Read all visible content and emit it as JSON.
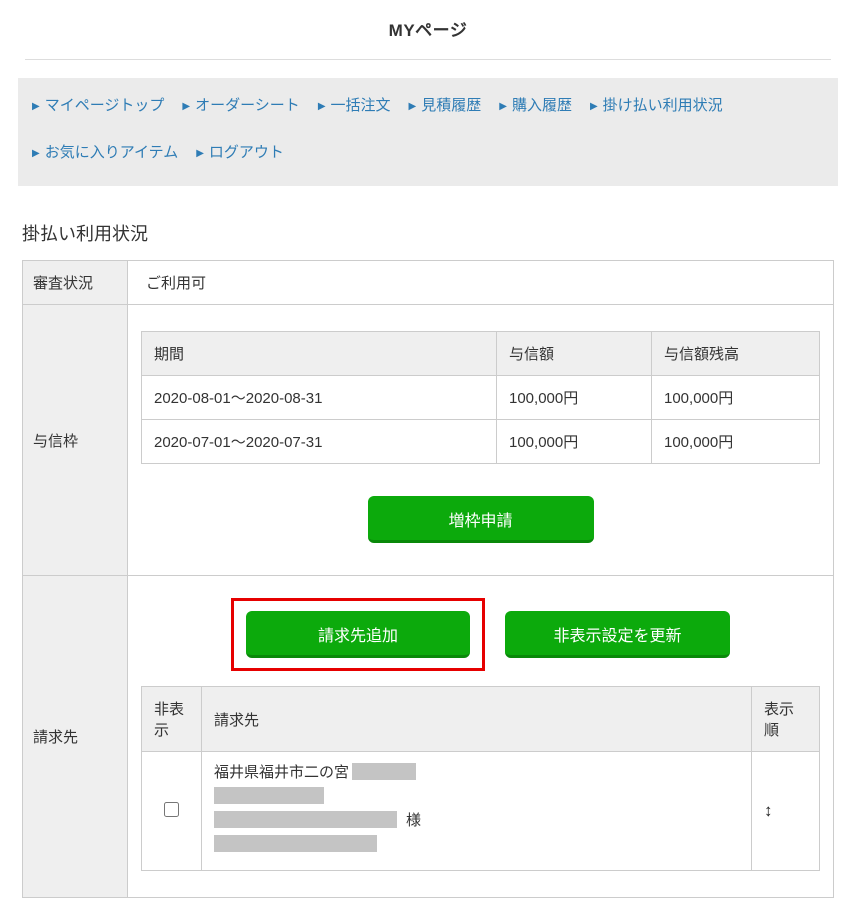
{
  "page": {
    "title": "MYページ"
  },
  "nav": {
    "marker": "▶",
    "items": [
      {
        "label": "マイページトップ"
      },
      {
        "label": "オーダーシート"
      },
      {
        "label": "一括注文"
      },
      {
        "label": "見積履歴"
      },
      {
        "label": "購入履歴"
      },
      {
        "label": "掛け払い利用状況"
      },
      {
        "label": "お気に入りアイテム"
      },
      {
        "label": "ログアウト"
      }
    ]
  },
  "section": {
    "heading": "掛払い利用状況"
  },
  "status": {
    "label": "審査状況",
    "value": "ご利用可"
  },
  "credit": {
    "label": "与信枠",
    "table": {
      "headers": [
        "期間",
        "与信額",
        "与信額残高"
      ],
      "rows": [
        [
          "2020-08-01〜2020-08-31",
          "100,000円",
          "100,000円"
        ],
        [
          "2020-07-01〜2020-07-31",
          "100,000円",
          "100,000円"
        ]
      ]
    },
    "increase_button_label": "増枠申請"
  },
  "billing": {
    "label": "請求先",
    "add_button_label": "請求先追加",
    "update_button_label": "非表示設定を更新",
    "table": {
      "headers": [
        "非表示",
        "請求先",
        "表示順"
      ],
      "row": {
        "address_line1": "福井県福井市二の宮",
        "honorific": "様",
        "sort_icon": "↕"
      }
    }
  },
  "colors": {
    "accent_green": "#0caa0c",
    "highlight_red": "#e60000",
    "link_blue": "#2e7cb5"
  }
}
